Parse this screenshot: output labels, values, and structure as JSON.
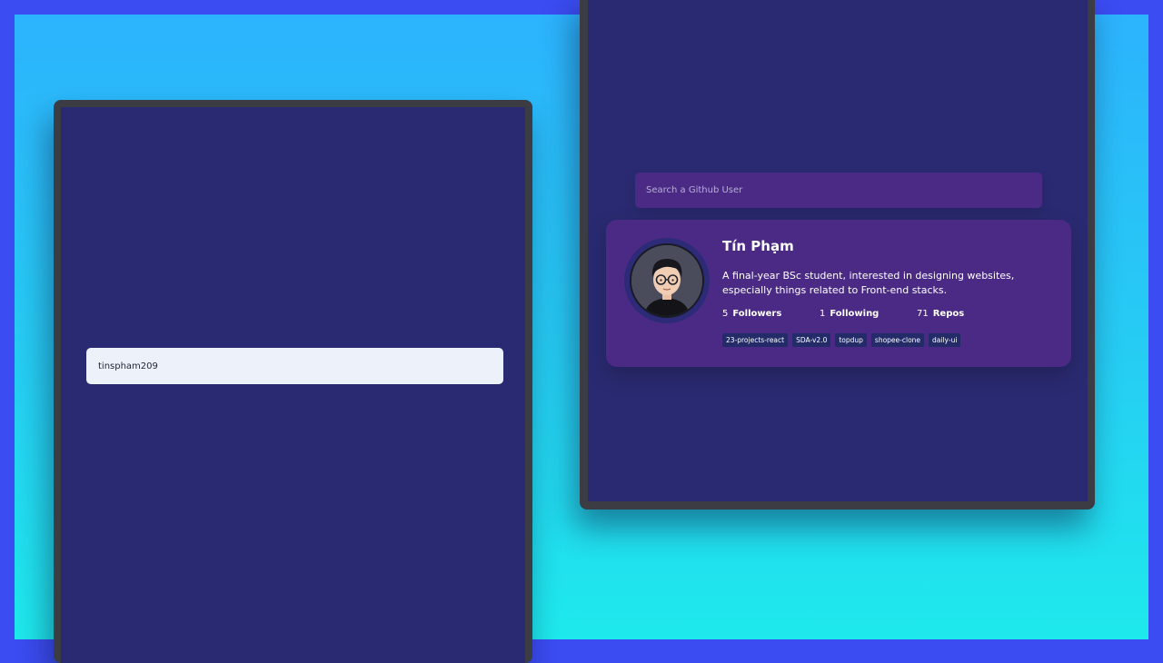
{
  "left_screen": {
    "search": {
      "value": "tinspham209"
    }
  },
  "right_screen": {
    "search": {
      "placeholder": "Search a Github User"
    },
    "profile": {
      "name": "Tín Phạm",
      "bio": "A final-year BSc student, interested in designing websites, especially things related to Front-end stacks.",
      "stats": [
        {
          "value": "5",
          "label": "Followers"
        },
        {
          "value": "1",
          "label": "Following"
        },
        {
          "value": "71",
          "label": "Repos"
        }
      ],
      "repos": [
        "23-projects-react",
        "SDA-v2.0",
        "topdup",
        "shopee-clone",
        "daily-ui"
      ],
      "avatar": "user-avatar-illustration"
    }
  },
  "colors": {
    "frame_border": "#3b4cf2",
    "background_gradient_top": "#2cb3fd",
    "background_gradient_bottom": "#1ee9ec",
    "device_bezel": "#3b3c44",
    "screen_bg": "#2a2a72",
    "card_bg": "#4b2a86",
    "repo_tag_bg": "#232b69",
    "light_input_bg": "#edf1fa"
  }
}
